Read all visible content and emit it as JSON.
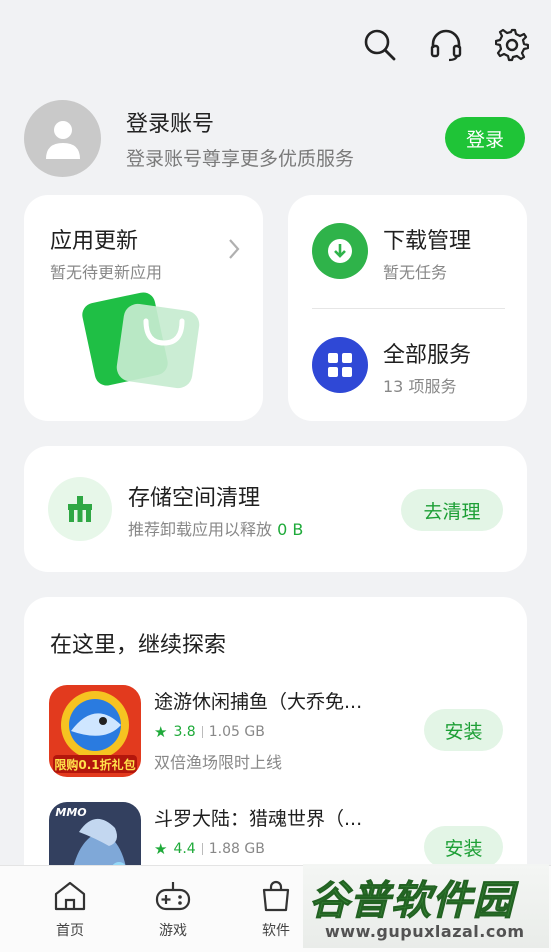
{
  "topbar": {
    "icons": [
      "search-icon",
      "headset-icon",
      "gear-icon"
    ]
  },
  "account": {
    "title": "登录账号",
    "subtitle": "登录账号尊享更多优质服务",
    "login_label": "登录"
  },
  "update_card": {
    "title": "应用更新",
    "subtitle": "暂无待更新应用"
  },
  "services": {
    "download": {
      "title": "下载管理",
      "subtitle": "暂无任务",
      "color": "#2fb34a"
    },
    "all": {
      "title": "全部服务",
      "subtitle": "13 项服务",
      "color": "#2f48d6"
    }
  },
  "storage": {
    "title": "存储空间清理",
    "subtitle_prefix": "推荐卸载应用以释放",
    "subtitle_value": "0 B",
    "button_label": "去清理"
  },
  "explore": {
    "heading": "在这里，继续探索",
    "apps": [
      {
        "name": "途游休闲捕鱼（大乔免...",
        "rating": "3.8",
        "size": "1.05 GB",
        "desc": "双倍渔场限时上线",
        "badge": "限购0.1折礼包",
        "action": "安装"
      },
      {
        "name": "斗罗大陆：猎魂世界（...",
        "rating": "4.4",
        "size": "1.88 GB",
        "desc": "",
        "badge": "MMO",
        "action": "安装"
      }
    ]
  },
  "bottom_tabs": [
    {
      "label": "首页",
      "icon": "home-icon"
    },
    {
      "label": "游戏",
      "icon": "gamepad-icon"
    },
    {
      "label": "软件",
      "icon": "bag-icon"
    }
  ],
  "watermark": {
    "title": "谷普软件园",
    "url": "www.gupuxlazal.com"
  },
  "colors": {
    "accent": "#1fc437",
    "accent_soft": "#e3f5e6",
    "background": "#f1f2f4"
  }
}
